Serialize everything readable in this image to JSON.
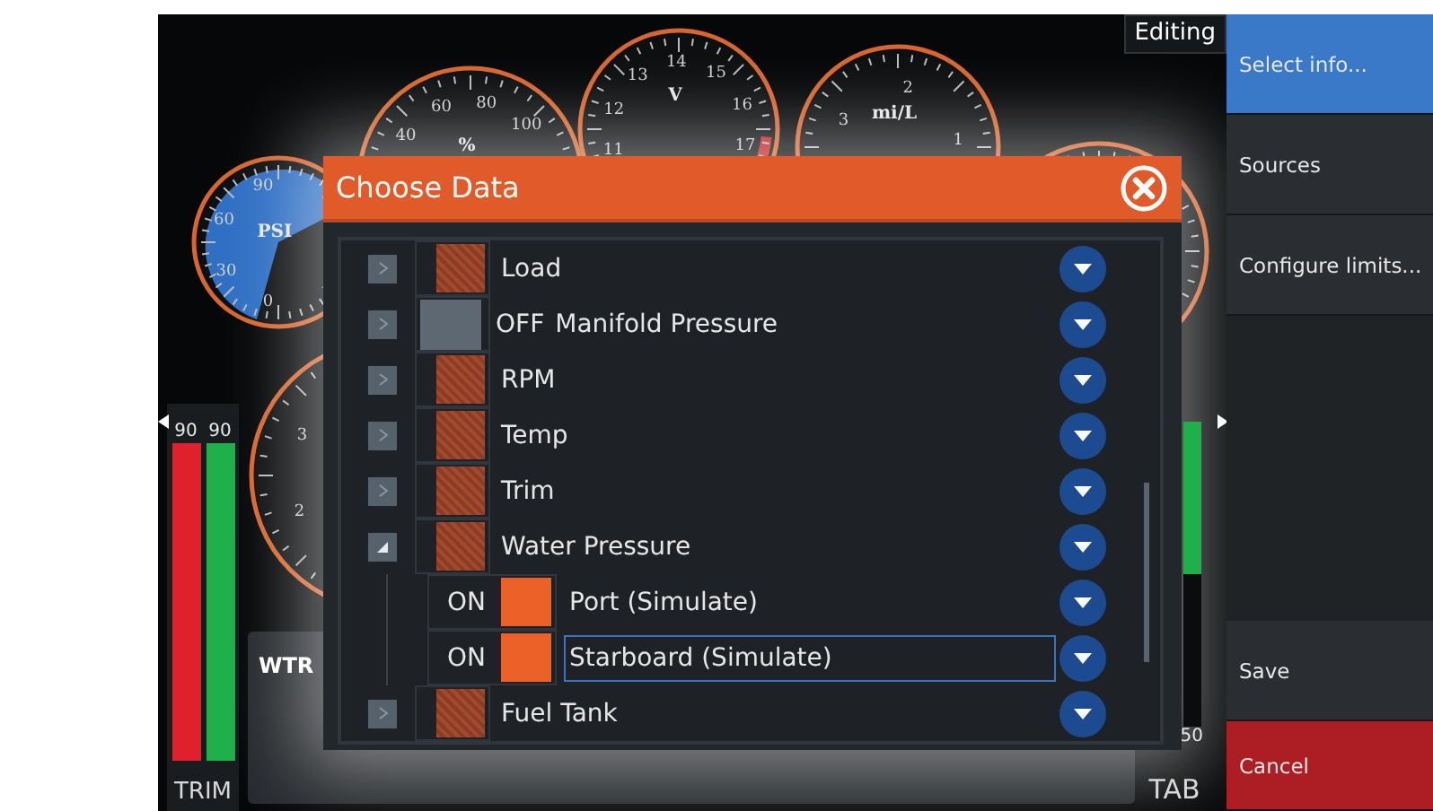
{
  "editing_badge": "Editing",
  "gauges": [
    {
      "kind": "pressure",
      "unit": "PSI",
      "ticks": [
        "0",
        "30",
        "60",
        "90"
      ]
    },
    {
      "kind": "dial",
      "unit": "%",
      "ticks": [
        "40",
        "60",
        "80",
        "100"
      ]
    },
    {
      "kind": "dial",
      "unit": "V",
      "ticks": [
        "11",
        "12",
        "13",
        "14",
        "15",
        "16",
        "17"
      ]
    },
    {
      "kind": "dial",
      "unit": "mi/L",
      "ticks": [
        "3",
        "2",
        "1"
      ]
    },
    {
      "kind": "dial",
      "ticks": [
        "3",
        "2"
      ]
    },
    {
      "kind": "dial"
    }
  ],
  "meters": [
    {
      "kind": "trim",
      "label": "TRIM",
      "bars": [
        {
          "reading": "90",
          "level": 1,
          "color": "#e0202a"
        },
        {
          "reading": "90",
          "level": 1,
          "color": "#1fb04c"
        }
      ]
    },
    {
      "kind": "tab",
      "label": "TAB",
      "bars": [
        {
          "reading": "50",
          "level": 0.5,
          "color": "#1fb04c"
        }
      ]
    }
  ],
  "data_panel": {
    "label": "WTR"
  },
  "dialog": {
    "title": "Choose Data",
    "rows": [
      {
        "kind": "group",
        "label": "Load",
        "expanded": false,
        "on": true,
        "selected": false
      },
      {
        "kind": "group",
        "label": "Manifold Pressure",
        "status": "OFF",
        "expanded": false,
        "on": false,
        "selected": false
      },
      {
        "kind": "group",
        "label": "RPM",
        "expanded": false,
        "on": true,
        "selected": false
      },
      {
        "kind": "group",
        "label": "Temp",
        "expanded": false,
        "on": true,
        "selected": false
      },
      {
        "kind": "group",
        "label": "Trim",
        "expanded": false,
        "on": true,
        "selected": false
      },
      {
        "kind": "group",
        "label": "Water Pressure",
        "expanded": true,
        "on": true,
        "selected": false
      },
      {
        "kind": "source",
        "label": "Port (Simulate)",
        "status": "ON",
        "on": true,
        "selected": false
      },
      {
        "kind": "source",
        "label": "Starboard (Simulate)",
        "status": "ON",
        "on": true,
        "selected": true
      },
      {
        "kind": "group",
        "label": "Fuel Tank",
        "expanded": false,
        "on": true,
        "selected": false
      }
    ]
  },
  "menu": [
    {
      "kind": "item",
      "label": "Select info...",
      "selected": true
    },
    {
      "kind": "item",
      "label": "Sources",
      "selected": false
    },
    {
      "kind": "item",
      "label": "Configure limits...",
      "selected": false
    },
    {
      "kind": "spacer"
    },
    {
      "kind": "item",
      "label": "Save",
      "selected": false
    },
    {
      "kind": "cancel",
      "label": "Cancel",
      "selected": false
    }
  ]
}
